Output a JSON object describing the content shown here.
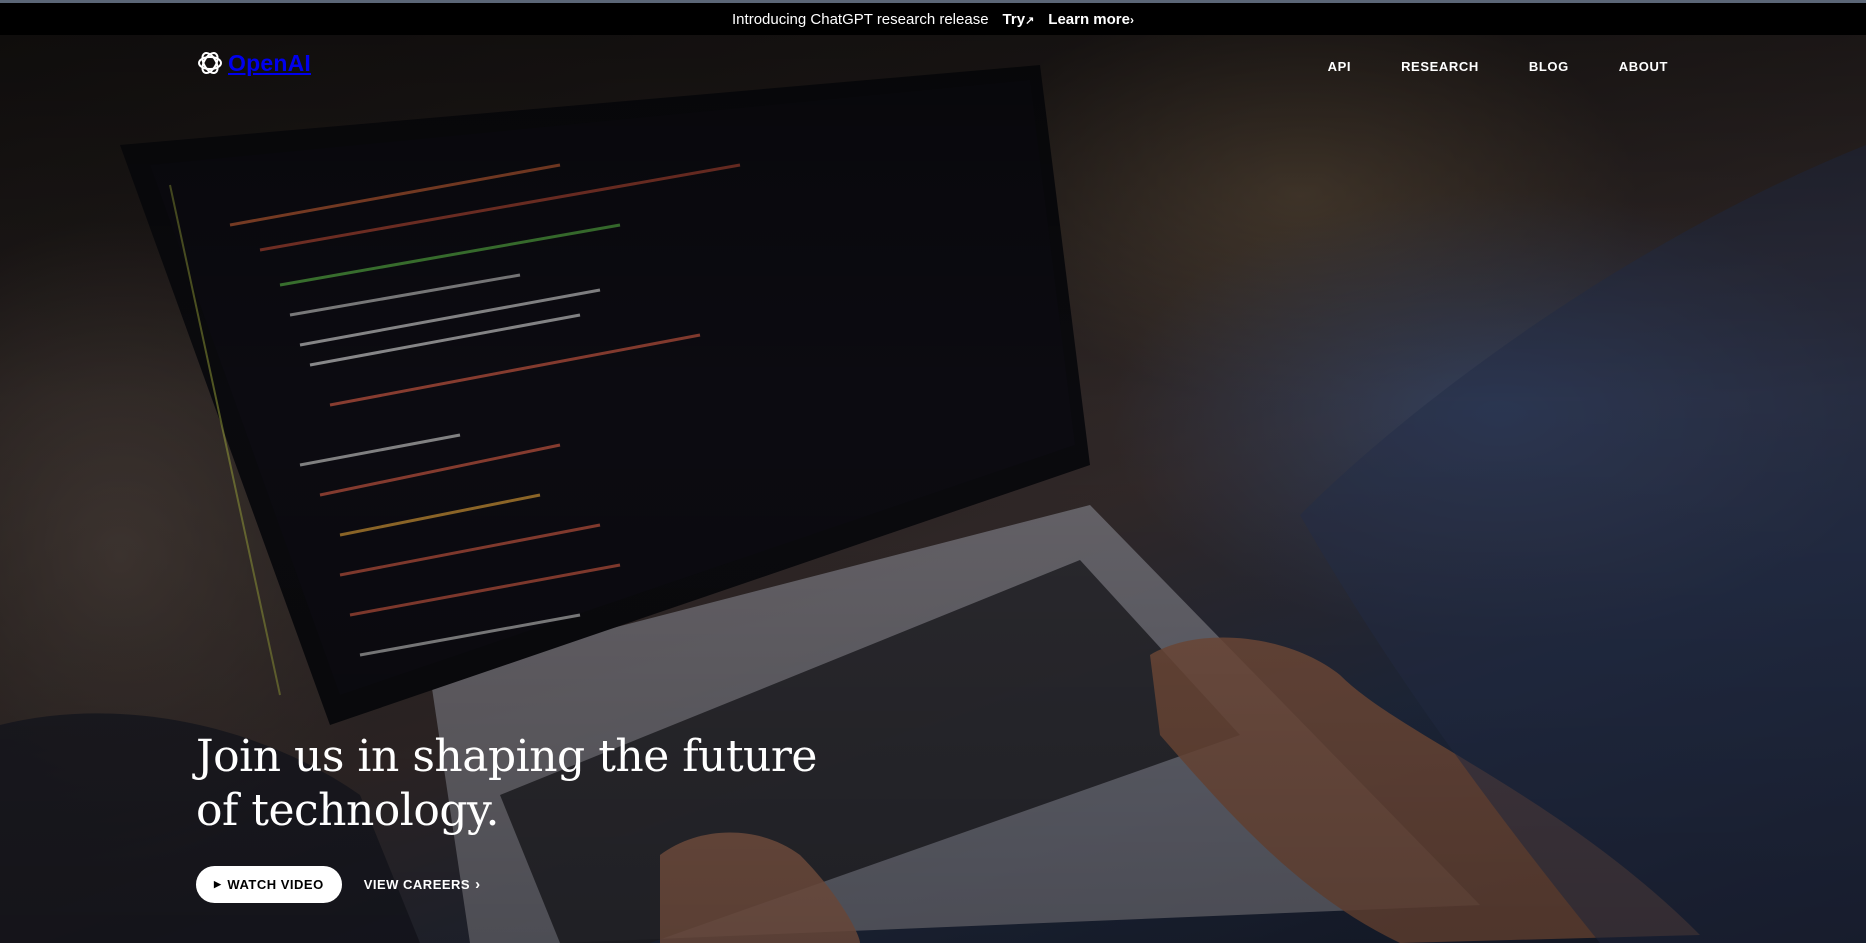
{
  "announcement": {
    "text": "Introducing ChatGPT research release",
    "try_label": "Try",
    "try_icon": "arrow-up-right-icon",
    "learn_label": "Learn more",
    "learn_icon": "chevron-right-icon"
  },
  "nav": {
    "logo_text": "OpenAI",
    "links": [
      {
        "label": "API"
      },
      {
        "label": "RESEARCH"
      },
      {
        "label": "BLOG"
      },
      {
        "label": "ABOUT"
      }
    ]
  },
  "hero": {
    "headline_line1": "Join us in shaping the future",
    "headline_line2": "of technology.",
    "watch_label": "WATCH VIDEO",
    "careers_label": "VIEW CAREERS",
    "watch_icon": "play-icon",
    "careers_icon": "chevron-right-icon"
  },
  "colors": {
    "background": "#000000",
    "text": "#ffffff",
    "button_bg": "#ffffff",
    "button_text": "#000000"
  }
}
